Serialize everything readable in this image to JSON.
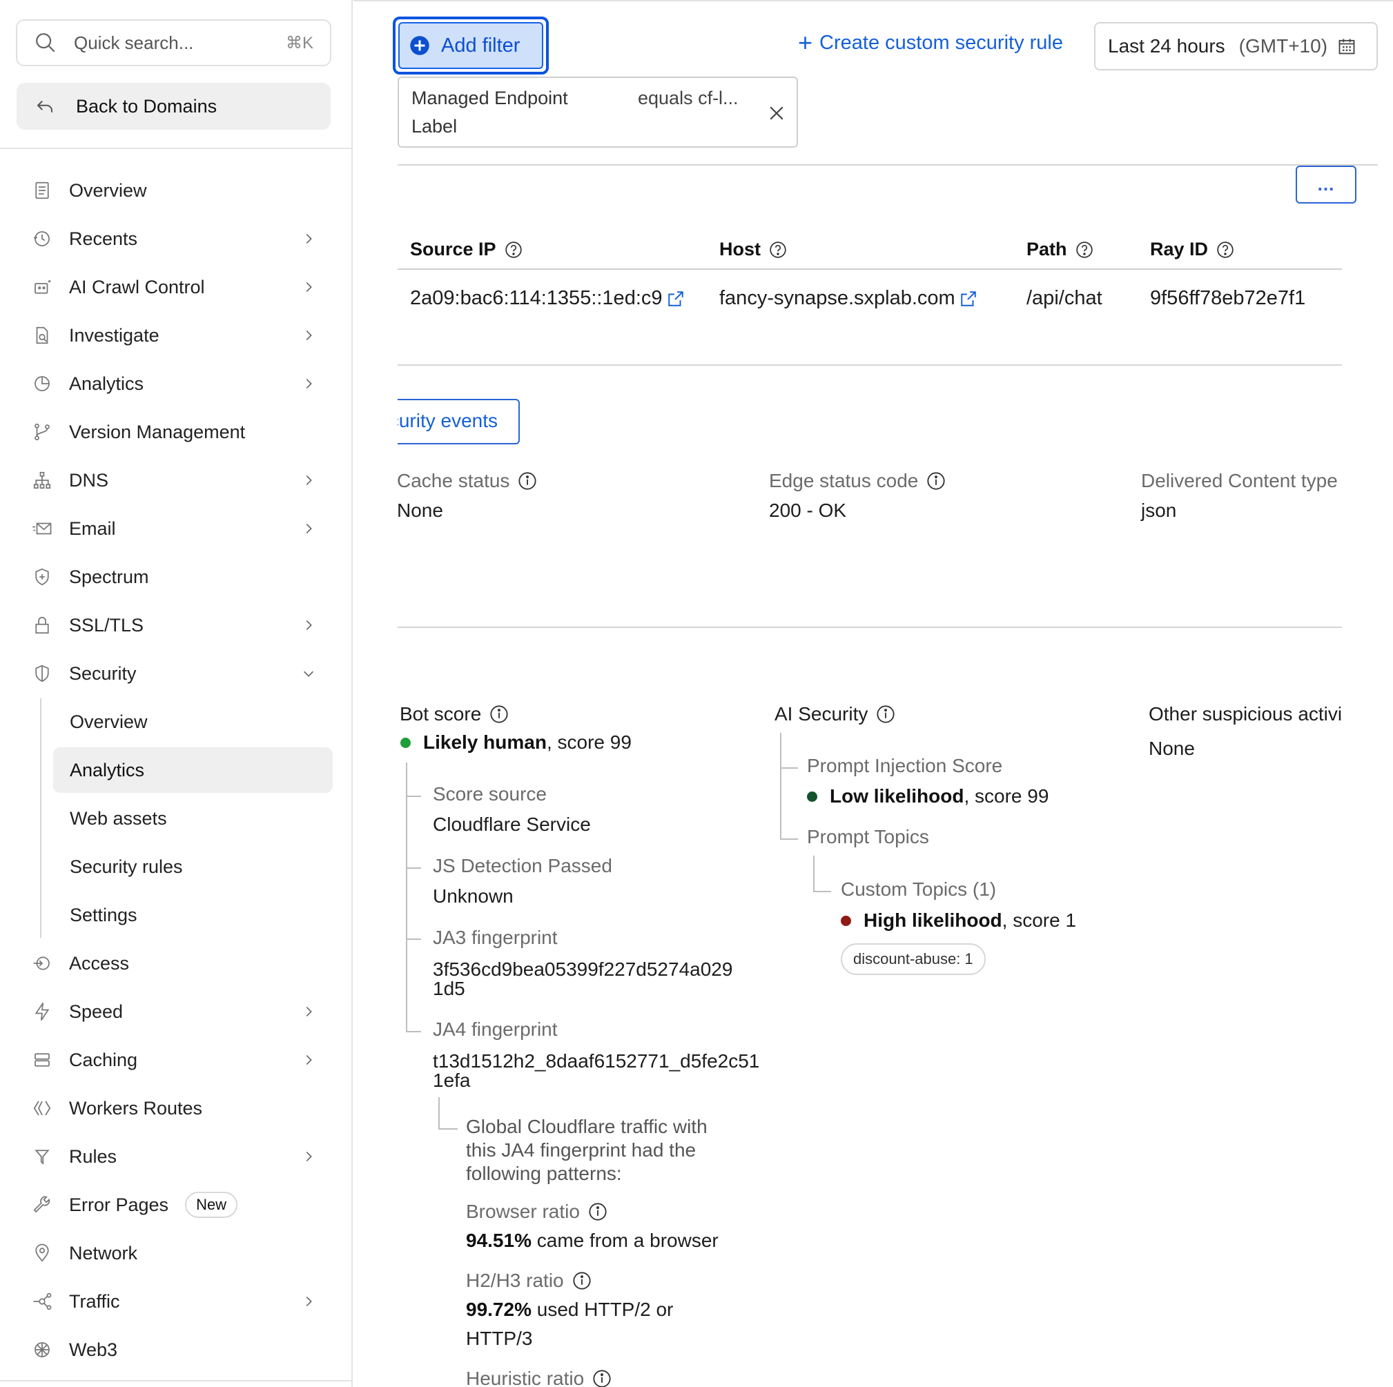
{
  "sidebar": {
    "search_placeholder": "Quick search...",
    "search_shortcut": "⌘K",
    "back_label": "Back to Domains",
    "items": [
      {
        "label": "Overview"
      },
      {
        "label": "Recents"
      },
      {
        "label": "AI Crawl Control"
      },
      {
        "label": "Investigate"
      },
      {
        "label": "Analytics"
      },
      {
        "label": "Version Management"
      },
      {
        "label": "DNS"
      },
      {
        "label": "Email"
      },
      {
        "label": "Spectrum"
      },
      {
        "label": "SSL/TLS"
      },
      {
        "label": "Security"
      },
      {
        "label": "Access"
      },
      {
        "label": "Speed"
      },
      {
        "label": "Caching"
      },
      {
        "label": "Workers Routes"
      },
      {
        "label": "Rules"
      },
      {
        "label": "Error Pages",
        "badge": "New"
      },
      {
        "label": "Network"
      },
      {
        "label": "Traffic"
      },
      {
        "label": "Web3"
      }
    ],
    "security_sub": [
      {
        "label": "Overview"
      },
      {
        "label": "Analytics"
      },
      {
        "label": "Web assets"
      },
      {
        "label": "Security rules"
      },
      {
        "label": "Settings"
      }
    ]
  },
  "toolbar": {
    "add_filter": "Add filter",
    "create_rule": "Create custom security rule",
    "time_range": "Last 24 hours",
    "timezone": "(GMT+10)"
  },
  "filter_chip": {
    "key_line1": "Managed Endpoint",
    "key_line2": "Label",
    "value": "equals cf-l..."
  },
  "table": {
    "more_button": "...",
    "headers": [
      "Source IP",
      "Host",
      "Path",
      "Ray ID"
    ],
    "row": {
      "source_ip": "2a09:bac6:114:1355::1ed:c9",
      "host": "fancy-synapse.sxplab.com",
      "path": "/api/chat",
      "ray_id": "9f56ff78eb72e7f1"
    }
  },
  "details": {
    "security_events_button": "Security events",
    "cache_status_label": "Cache status",
    "cache_status_value": "None",
    "edge_status_label": "Edge status code",
    "edge_status_value": "200 - OK",
    "content_type_label": "Delivered Content type",
    "content_type_value": "json"
  },
  "bot": {
    "label": "Bot score",
    "likelihood": "Likely human",
    "score": ", score 99",
    "score_source_label": "Score source",
    "score_source_value": "Cloudflare Service",
    "js_label": "JS Detection Passed",
    "js_value": "Unknown",
    "ja3_label": "JA3 fingerprint",
    "ja3_line1": "3f536cd9bea05399f227d5274a029",
    "ja3_line2": "1d5",
    "ja4_label": "JA4 fingerprint",
    "ja4_line1": "t13d1512h2_8daaf6152771_d5fe2c51",
    "ja4_line2": "1efa",
    "global_line1": "Global Cloudflare traffic with",
    "global_line2": "this JA4 fingerprint had the",
    "global_line3": "following patterns:",
    "browser_label": "Browser ratio",
    "browser_pct": "94.51%",
    "browser_text": " came from a browser",
    "h2_label": "H2/H3 ratio",
    "h2_pct": "99.72%",
    "h2_text1": " used HTTP/2 or",
    "h2_text2": "HTTP/3",
    "heuristic_label": "Heuristic ratio"
  },
  "ai_security": {
    "label": "AI Security",
    "prompt_injection_label": "Prompt Injection Score",
    "prompt_injection_likelihood": "Low likelihood",
    "prompt_injection_score": ", score 99",
    "prompt_topics_label": "Prompt Topics",
    "custom_topics_label": "Custom Topics (1)",
    "custom_likelihood": "High likelihood",
    "custom_score": ", score 1",
    "tag": "discount-abuse: 1"
  },
  "other": {
    "label": "Other suspicious activity",
    "value": "None"
  },
  "colors": {
    "accent": "#1560d8",
    "green": "#1f9d3a",
    "dark_green": "#14532d",
    "red": "#8f1a16"
  }
}
